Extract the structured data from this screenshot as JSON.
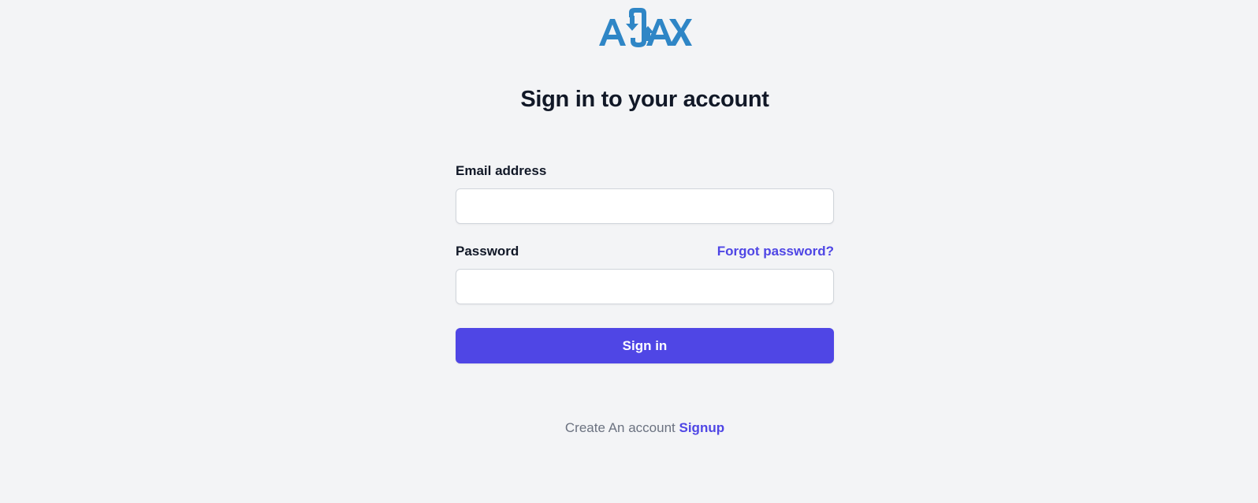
{
  "brand": {
    "logo_text": "AJAX",
    "logo_color": "#2f86c6"
  },
  "header": {
    "title": "Sign in to your account"
  },
  "form": {
    "email": {
      "label": "Email address",
      "value": "",
      "placeholder": ""
    },
    "password": {
      "label": "Password",
      "value": "",
      "placeholder": ""
    },
    "forgot_password_label": "Forgot password?",
    "submit_label": "Sign in"
  },
  "footer": {
    "prompt_text": "Create An account",
    "signup_label": "Signup"
  },
  "colors": {
    "background": "#f3f4f6",
    "accent": "#4f46e5",
    "heading": "#111827",
    "muted": "#6b7280"
  },
  "icons": {
    "logo": "ajax-logo-icon"
  }
}
